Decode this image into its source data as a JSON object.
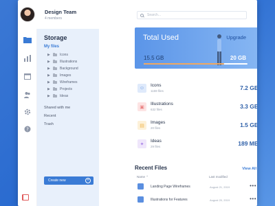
{
  "team": {
    "name": "Design Team",
    "members": "4 members"
  },
  "sidebar": {
    "title": "Storage",
    "my_files": "My files",
    "folders": [
      {
        "label": "Icons"
      },
      {
        "label": "Illustrations"
      },
      {
        "label": "Background"
      },
      {
        "label": "Images"
      },
      {
        "label": "Wireframes"
      },
      {
        "label": "Projects"
      },
      {
        "label": "Ideas"
      }
    ],
    "links": [
      "Shared with me",
      "Recent",
      "Trash"
    ],
    "create_label": "Create new"
  },
  "search": {
    "placeholder": "Search..."
  },
  "total": {
    "title": "Total Used",
    "upgrade": "Upgrade",
    "used": "15.5 GB",
    "capacity": "20 GB",
    "fraction": 0.775
  },
  "categories": [
    {
      "name": "Icons",
      "count": "1159 files",
      "size": "7.2 GB",
      "icon": "smile-icon",
      "color": "#dfeafb",
      "fg": "#5b8fe0"
    },
    {
      "name": "Illustrations",
      "count": "632 files",
      "size": "3.3 GB",
      "icon": "image-icon",
      "color": "#fde4e4",
      "fg": "#e98080"
    },
    {
      "name": "Images",
      "count": "20 files",
      "size": "1.5 GB",
      "icon": "picture-icon",
      "color": "#fdf1d9",
      "fg": "#efb54d"
    },
    {
      "name": "Ideas",
      "count": "29 files",
      "size": "189 MB",
      "icon": "bulb-icon",
      "color": "#efe6fb",
      "fg": "#a57ee6"
    }
  ],
  "recent": {
    "title": "Recent Files",
    "view_all": "View All",
    "col_name": "Name",
    "col_modified": "Last modified",
    "files": [
      {
        "name": "Landing Page Wireframes",
        "date": "August 21, 2019"
      },
      {
        "name": "Illustrations for Features",
        "date": "August 20, 2019"
      }
    ]
  }
}
